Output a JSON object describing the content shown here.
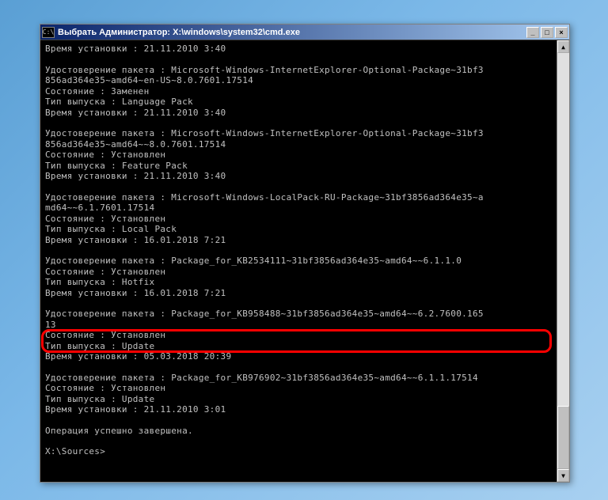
{
  "titlebar": {
    "icon_text": "C:\\",
    "title": "Выбрать Администратор: X:\\windows\\system32\\cmd.exe",
    "minimize": "_",
    "maximize": "□",
    "close": "×"
  },
  "scrollbar": {
    "up": "▲",
    "down": "▼"
  },
  "blocks": [
    {
      "lines": [
        "Время установки : 21.11.2010 3:40"
      ]
    },
    {
      "lines": [
        "Удостоверение пакета : Microsoft-Windows-InternetExplorer-Optional-Package~31bf3",
        "856ad364e35~amd64~en-US~8.0.7601.17514",
        "Состояние : Заменен",
        "Тип выпуска : Language Pack",
        "Время установки : 21.11.2010 3:40"
      ]
    },
    {
      "lines": [
        "Удостоверение пакета : Microsoft-Windows-InternetExplorer-Optional-Package~31bf3",
        "856ad364e35~amd64~~8.0.7601.17514",
        "Состояние : Установлен",
        "Тип выпуска : Feature Pack",
        "Время установки : 21.11.2010 3:40"
      ]
    },
    {
      "lines": [
        "Удостоверение пакета : Microsoft-Windows-LocalPack-RU-Package~31bf3856ad364e35~a",
        "md64~~6.1.7601.17514",
        "Состояние : Установлен",
        "Тип выпуска : Local Pack",
        "Время установки : 16.01.2018 7:21"
      ]
    },
    {
      "lines": [
        "Удостоверение пакета : Package_for_KB2534111~31bf3856ad364e35~amd64~~6.1.1.0",
        "Состояние : Установлен",
        "Тип выпуска : Hotfix",
        "Время установки : 16.01.2018 7:21"
      ]
    },
    {
      "lines": [
        "Удостоверение пакета : Package_for_KB958488~31bf3856ad364e35~amd64~~6.2.7600.165",
        "13",
        "Состояние : Установлен",
        "Тип выпуска : Update",
        "Время установки : 05.03.2018 20:39"
      ]
    },
    {
      "lines": [
        "Удостоверение пакета : Package_for_KB976902~31bf3856ad364e35~amd64~~6.1.1.17514",
        "Состояние : Установлен",
        "Тип выпуска : Update",
        "Время установки : 21.11.2010 3:01"
      ]
    },
    {
      "lines": [
        "Операция успешно завершена."
      ]
    },
    {
      "lines": [
        "X:\\Sources>"
      ]
    }
  ]
}
